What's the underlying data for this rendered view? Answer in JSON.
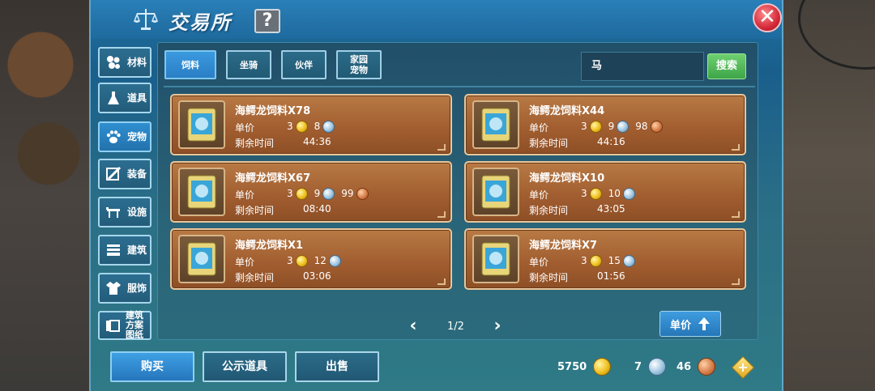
{
  "header": {
    "title": "交易所",
    "help_label": "?",
    "close_label": "✕"
  },
  "sidebar": {
    "items": [
      {
        "label": "材料",
        "icon": "materials-icon"
      },
      {
        "label": "道具",
        "icon": "flask-icon"
      },
      {
        "label": "宠物",
        "icon": "paw-icon",
        "active": true
      },
      {
        "label": "装备",
        "icon": "equipment-icon"
      },
      {
        "label": "设施",
        "icon": "facility-icon"
      },
      {
        "label": "建筑",
        "icon": "building-icon"
      },
      {
        "label": "服饰",
        "icon": "clothing-icon"
      },
      {
        "label": "建筑方案图纸",
        "icon": "blueprint-icon"
      }
    ]
  },
  "category_tabs": [
    {
      "label": "饲料",
      "active": true
    },
    {
      "label": "坐骑"
    },
    {
      "label": "伙伴"
    },
    {
      "label": "家园宠物"
    }
  ],
  "search": {
    "value": "马",
    "button_label": "搜索"
  },
  "listings": {
    "price_label": "单价",
    "time_label": "剩余时间",
    "items": [
      {
        "name": "海鳄龙饲料X78",
        "gold": "3",
        "silver": "8",
        "copper": null,
        "time": "44:36"
      },
      {
        "name": "海鳄龙饲料X44",
        "gold": "3",
        "silver": "9",
        "copper": "98",
        "time": "44:16"
      },
      {
        "name": "海鳄龙饲料X67",
        "gold": "3",
        "silver": "9",
        "copper": "99",
        "time": "08:40"
      },
      {
        "name": "海鳄龙饲料X10",
        "gold": "3",
        "silver": "10",
        "copper": null,
        "time": "43:05"
      },
      {
        "name": "海鳄龙饲料X1",
        "gold": "3",
        "silver": "12",
        "copper": null,
        "time": "03:06"
      },
      {
        "name": "海鳄龙饲料X7",
        "gold": "3",
        "silver": "15",
        "copper": null,
        "time": "01:56"
      }
    ]
  },
  "pagination": {
    "text": "1/2"
  },
  "sort": {
    "label": "单价"
  },
  "footer": {
    "buy_label": "购买",
    "showcase_label": "公示道具",
    "sell_label": "出售",
    "gold": "5750",
    "silver": "7",
    "copper": "46",
    "add_label": "+"
  },
  "colors": {
    "gold": "#f0c020",
    "silver": "#9fc6e0",
    "copper": "#d6804a",
    "accent_green": "#3da548",
    "panel_blue": "#1e6fa0"
  }
}
